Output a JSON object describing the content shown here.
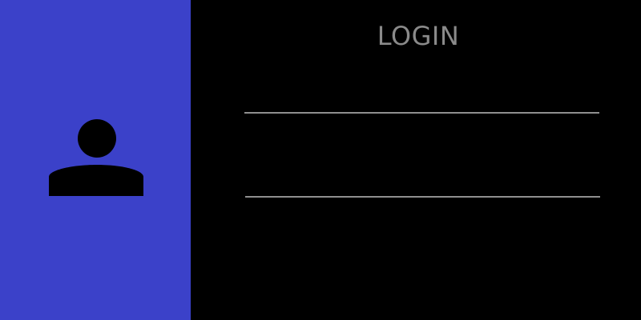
{
  "sidebar": {
    "icon": "user-icon",
    "background_color": "#3b41c9"
  },
  "login_form": {
    "title": "LOGIN",
    "username": {
      "value": "",
      "placeholder": ""
    },
    "password": {
      "value": "",
      "placeholder": ""
    }
  },
  "colors": {
    "page_background": "#000000",
    "title_text": "#8a8a8a",
    "field_underline": "#8f8f8f"
  }
}
